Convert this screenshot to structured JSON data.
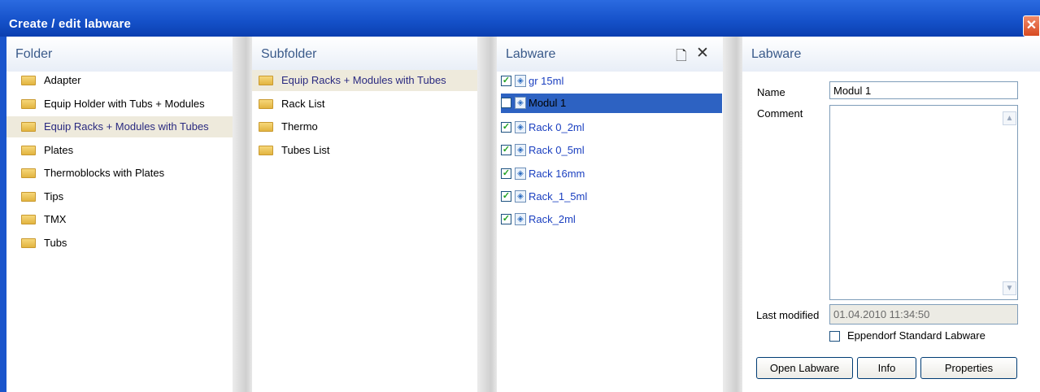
{
  "window": {
    "title": "Create / edit labware",
    "close_glyph": "✕"
  },
  "folder": {
    "header": "Folder",
    "items": [
      {
        "label": "Adapter",
        "selected": false
      },
      {
        "label": "Equip Holder with Tubs + Modules",
        "selected": false
      },
      {
        "label": "Equip Racks + Modules with Tubes",
        "selected": true
      },
      {
        "label": "Plates",
        "selected": false
      },
      {
        "label": "Thermoblocks with Plates",
        "selected": false
      },
      {
        "label": "Tips",
        "selected": false
      },
      {
        "label": "TMX",
        "selected": false
      },
      {
        "label": "Tubs",
        "selected": false
      }
    ]
  },
  "subfolder": {
    "header": "Subfolder",
    "items": [
      {
        "label": "Equip Racks + Modules with Tubes",
        "selected": true
      },
      {
        "label": "Rack List",
        "selected": false
      },
      {
        "label": "Thermo",
        "selected": false
      },
      {
        "label": "Tubes List",
        "selected": false
      }
    ]
  },
  "labware_list": {
    "header": "Labware",
    "new_icon": "new-document-icon",
    "delete_icon": "delete-x-icon",
    "items": [
      {
        "label": "gr 15ml",
        "checked": true,
        "selected": false
      },
      {
        "label": "Modul 1",
        "checked": false,
        "selected": true
      },
      {
        "label": "Rack 0_2ml",
        "checked": true,
        "selected": false
      },
      {
        "label": "Rack 0_5ml",
        "checked": true,
        "selected": false
      },
      {
        "label": "Rack 16mm",
        "checked": true,
        "selected": false
      },
      {
        "label": "Rack_1_5ml",
        "checked": true,
        "selected": false
      },
      {
        "label": "Rack_2ml",
        "checked": true,
        "selected": false
      }
    ]
  },
  "details": {
    "header": "Labware",
    "name_label": "Name",
    "name_value": "Modul 1",
    "comment_label": "Comment",
    "comment_value": "",
    "last_modified_label": "Last modified",
    "last_modified_value": "01.04.2010 11:34:50",
    "standard_label": "Eppendorf Standard Labware",
    "standard_checked": false,
    "buttons": {
      "open": "Open Labware",
      "info": "Info",
      "properties": "Properties"
    }
  },
  "colors": {
    "titlebar": "#1450c8",
    "selection": "#2d62c2",
    "highlight": "#eeeadc"
  }
}
